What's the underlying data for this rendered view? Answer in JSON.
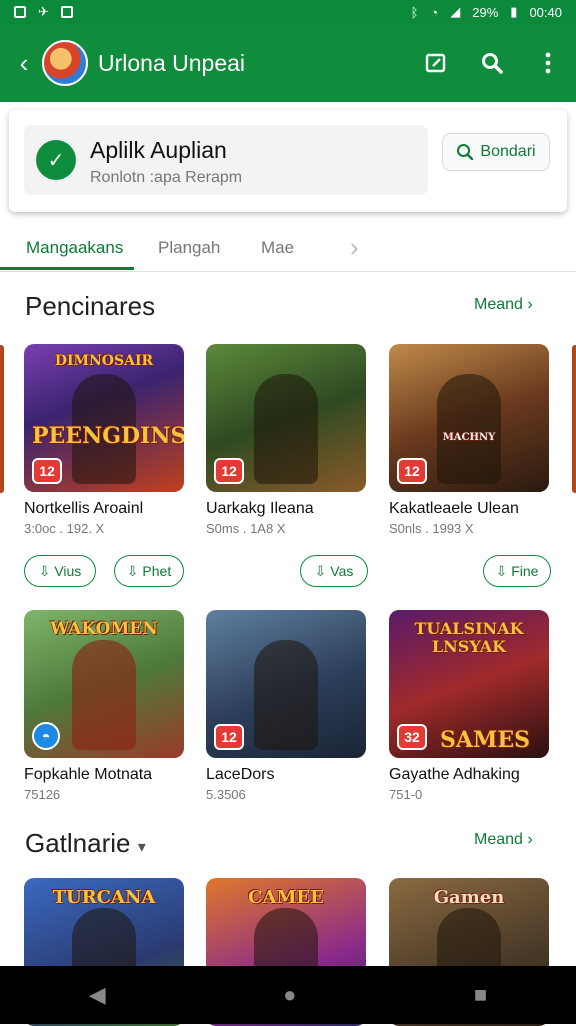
{
  "status_bar": {
    "time": "00:40",
    "battery": "29%"
  },
  "app_bar": {
    "title": "Urlona Unpeai",
    "icons": [
      "back-icon",
      "edit-icon",
      "search-icon",
      "more-vert-icon"
    ]
  },
  "search_card": {
    "title": "Aplilk Auplian",
    "subtitle": "Ronlotn :apa Rerapm",
    "button_label": "Bondari"
  },
  "tabs": [
    {
      "label": "Mangaakans"
    },
    {
      "label": "Plangah"
    },
    {
      "label": "Mae"
    }
  ],
  "section1": {
    "title": "Pencinares",
    "more": "Meand",
    "row1": [
      {
        "art_text": "PEENGDINS",
        "art_top": "DIMNOSAIR",
        "badge": "12",
        "name": "Nortkellis Aroainl",
        "meta": "3:0oc . 192. X",
        "pills": [
          "Vius",
          "Phet"
        ]
      },
      {
        "art_text": "",
        "art_top": "",
        "badge": "12",
        "name": "Uarkakg Ileana",
        "meta": "S0ms . 1A8 X",
        "pills": [
          "Vas"
        ]
      },
      {
        "art_text": "",
        "art_top": "MACHNY",
        "badge": "12",
        "name": "Kakatleaele Ulean",
        "meta": "S0nls . 1993 X",
        "pills": [
          "Fine"
        ]
      }
    ],
    "row2": [
      {
        "art_text": "",
        "art_top": "WAKOMEN",
        "badge": "",
        "name": "Fopkahle Motnata",
        "meta": "75126"
      },
      {
        "art_text": "",
        "art_top": "",
        "badge": "12",
        "name": "LaceDors",
        "meta": "5.3506"
      },
      {
        "art_text": "SAMES",
        "art_top": "TUALSINAK LNSYAK",
        "badge": "32",
        "name": "Gayathe Adhaking",
        "meta": "751-0"
      }
    ]
  },
  "section2": {
    "title": "Gatlnarie",
    "more": "Meand",
    "row": [
      {
        "art_top": "TURCANA"
      },
      {
        "art_top": "CAMEE"
      },
      {
        "art_top": "Gamen"
      }
    ]
  },
  "colors": {
    "primary": "#0f8d3c",
    "accent_text": "#0f7a36",
    "badge_red": "#e53935"
  }
}
